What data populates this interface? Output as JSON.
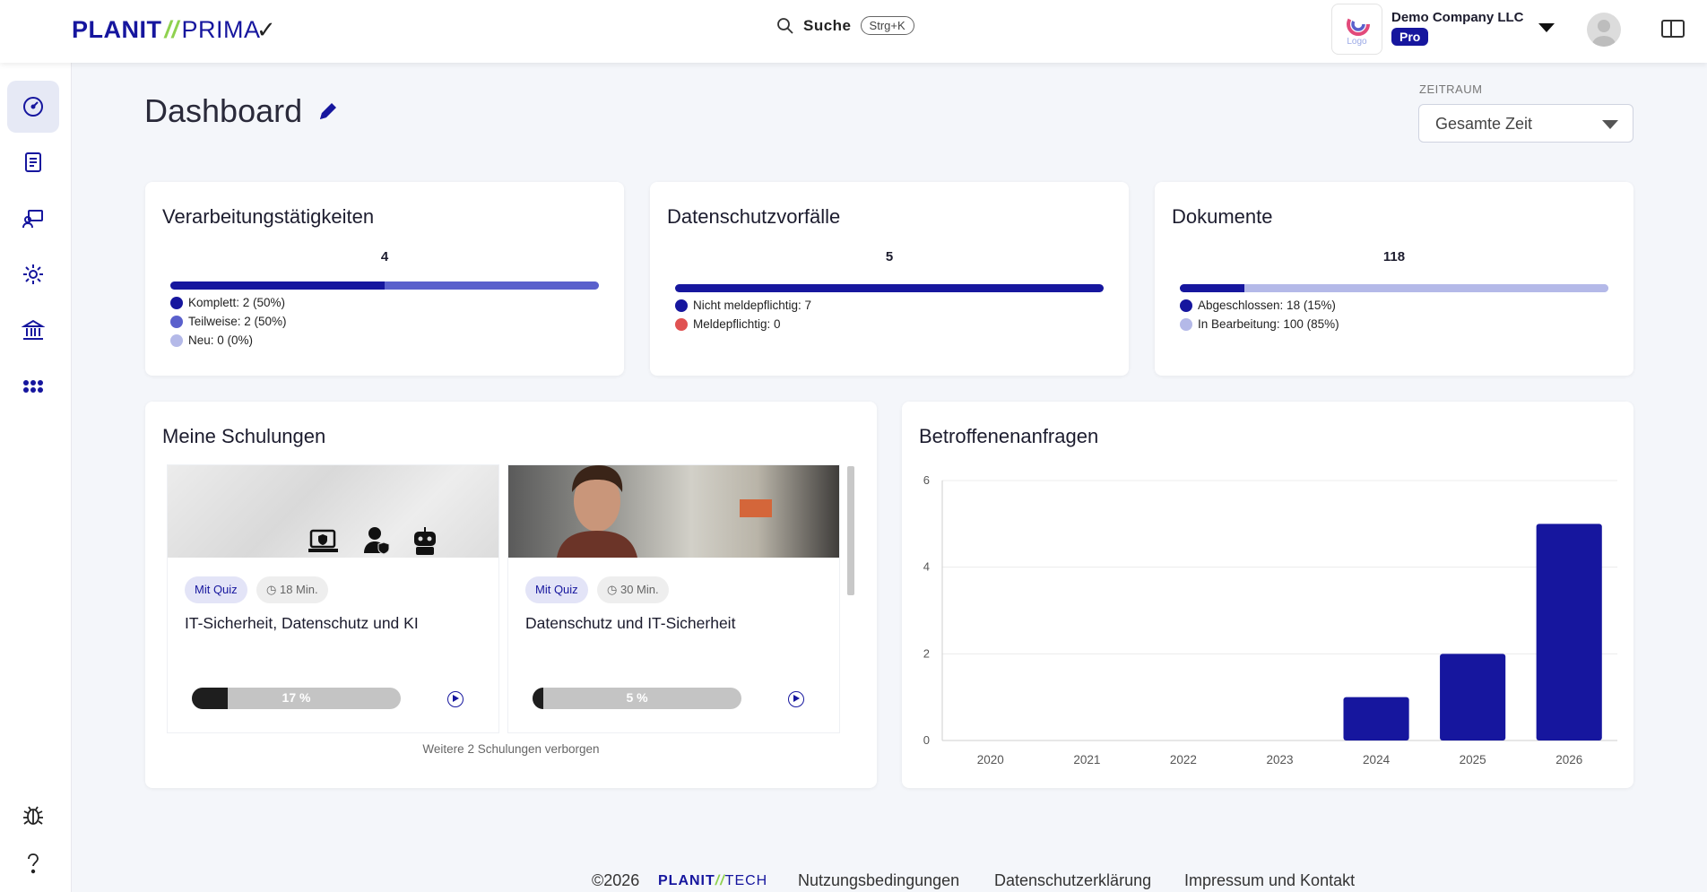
{
  "header": {
    "logo_left": "PLANIT",
    "logo_sep": "//",
    "logo_right": "PRIMA",
    "search_label": "Suche",
    "search_shortcut": "Strg+K",
    "company_logo_text": "Logo",
    "company_name": "Demo Company LLC",
    "plan_badge": "Pro"
  },
  "sidebar": {
    "items": [
      {
        "name": "dashboard",
        "icon": "dashboard-gauge-icon",
        "active": true
      },
      {
        "name": "documents",
        "icon": "document-icon"
      },
      {
        "name": "trainings",
        "icon": "training-icon"
      },
      {
        "name": "settings",
        "icon": "gear-icon"
      },
      {
        "name": "institution",
        "icon": "bank-icon"
      },
      {
        "name": "apps",
        "icon": "apps-grid-icon"
      }
    ],
    "bottom": [
      {
        "name": "bug-report",
        "icon": "bug-icon"
      },
      {
        "name": "help",
        "icon": "help-icon"
      }
    ]
  },
  "page": {
    "title": "Dashboard",
    "zeitraum_label": "ZEITRAUM",
    "zeitraum_value": "Gesamte Zeit"
  },
  "stats": {
    "verarbeitung": {
      "title": "Verarbeitungstätigkeiten",
      "total": "4",
      "legend": [
        "Komplett: 2 (50%)",
        "Teilweise: 2 (50%)",
        "Neu: 0 (0%)"
      ],
      "shares": [
        0.5,
        0.5,
        0
      ]
    },
    "vorfaelle": {
      "title": "Datenschutzvorfälle",
      "total": "5",
      "legend": [
        "Nicht meldepflichtig: 7",
        "Meldepflichtig: 0"
      ],
      "shares": [
        1,
        0
      ]
    },
    "dokumente": {
      "title": "Dokumente",
      "total": "118",
      "legend": [
        "Abgeschlossen: 18 (15%)",
        "In Bearbeitung: 100 (85%)"
      ],
      "shares": [
        0.15,
        0.85
      ]
    },
    "colors": {
      "dark": "#16169e",
      "mid": "#5a60cc",
      "light": "#b4b9e8",
      "red": "#e05252"
    }
  },
  "trainings": {
    "title": "Meine Schulungen",
    "items": [
      {
        "quiz": "Mit Quiz",
        "duration": "18 Min.",
        "title": "IT-Sicherheit, Datenschutz und KI",
        "progress_label": "17 %",
        "progress": 0.17
      },
      {
        "quiz": "Mit Quiz",
        "duration": "30 Min.",
        "title": "Datenschutz und IT-Sicherheit",
        "progress_label": "5 %",
        "progress": 0.05
      }
    ],
    "hidden_note": "Weitere 2 Schulungen verborgen"
  },
  "requests": {
    "title": "Betroffenenanfragen"
  },
  "chart_data": {
    "type": "bar",
    "title": "Betroffenenanfragen",
    "categories": [
      "2020",
      "2021",
      "2022",
      "2023",
      "2024",
      "2025",
      "2026"
    ],
    "values": [
      0,
      0,
      0,
      0,
      1,
      2,
      5
    ],
    "yticks": [
      "0",
      "2",
      "4",
      "6"
    ],
    "ylim": [
      0,
      6
    ],
    "color": "#16169e",
    "grid": true
  },
  "footer": {
    "copyright": "©2026",
    "brand_left": "PLANIT",
    "brand_sep": "//",
    "brand_right": "TECH",
    "links": [
      "Nutzungsbedingungen",
      "Datenschutzerklärung",
      "Impressum und Kontakt"
    ]
  }
}
